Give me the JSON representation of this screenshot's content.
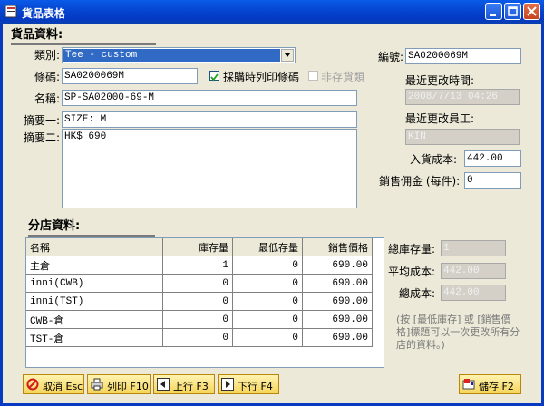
{
  "window": {
    "title": "貨品表格"
  },
  "product_section": {
    "heading": "貨品資料:",
    "category_label": "類別:",
    "category_value": "Tee - custom",
    "barcode_label": "條碼:",
    "barcode_value": "SA0200069M",
    "print_barcode_label": "採購時列印條碼",
    "print_barcode_checked": true,
    "non_stock_label": "非存貨類",
    "non_stock_checked": false,
    "name_label": "名稱:",
    "name_value": "SP-SA02000-69-M",
    "summary1_label": "摘要一:",
    "summary1_value": "SIZE: M",
    "summary2_label": "摘要二:",
    "summary2_value": "HK$ 690"
  },
  "right_panel": {
    "code_label": "編號:",
    "code_value": "SA0200069M",
    "last_modified_label": "最近更改時間:",
    "last_modified_value": "2008/7/13 04:26",
    "last_staff_label": "最近更改員工:",
    "last_staff_value": "KIN",
    "cost_label": "入貨成本:",
    "cost_value": "442.00",
    "commission_label": "銷售佣金 (每件):",
    "commission_value": "0"
  },
  "branch_section": {
    "heading": "分店資料:",
    "columns": [
      "名稱",
      "庫存量",
      "最低存量",
      "銷售價格"
    ],
    "rows": [
      [
        "主倉",
        "1",
        "0",
        "690.00"
      ],
      [
        "inni(CWB)",
        "0",
        "0",
        "690.00"
      ],
      [
        "inni(TST)",
        "0",
        "0",
        "690.00"
      ],
      [
        "CWB-倉",
        "0",
        "0",
        "690.00"
      ],
      [
        "TST-倉",
        "0",
        "0",
        "690.00"
      ]
    ]
  },
  "totals": {
    "total_stock_label": "總庫存量:",
    "total_stock_value": "1",
    "avg_cost_label": "平均成本:",
    "avg_cost_value": "442.00",
    "total_cost_label": "總成本:",
    "total_cost_value": "442.00",
    "note": "(按 [最低庫存] 或 [銷售價格]標題可以一次更改所有分店的資料。)"
  },
  "buttons": {
    "cancel": "取消 Esc",
    "print": "列印 F10",
    "prev": "上行 F3",
    "next": "下行 F4",
    "save": "儲存 F2"
  }
}
